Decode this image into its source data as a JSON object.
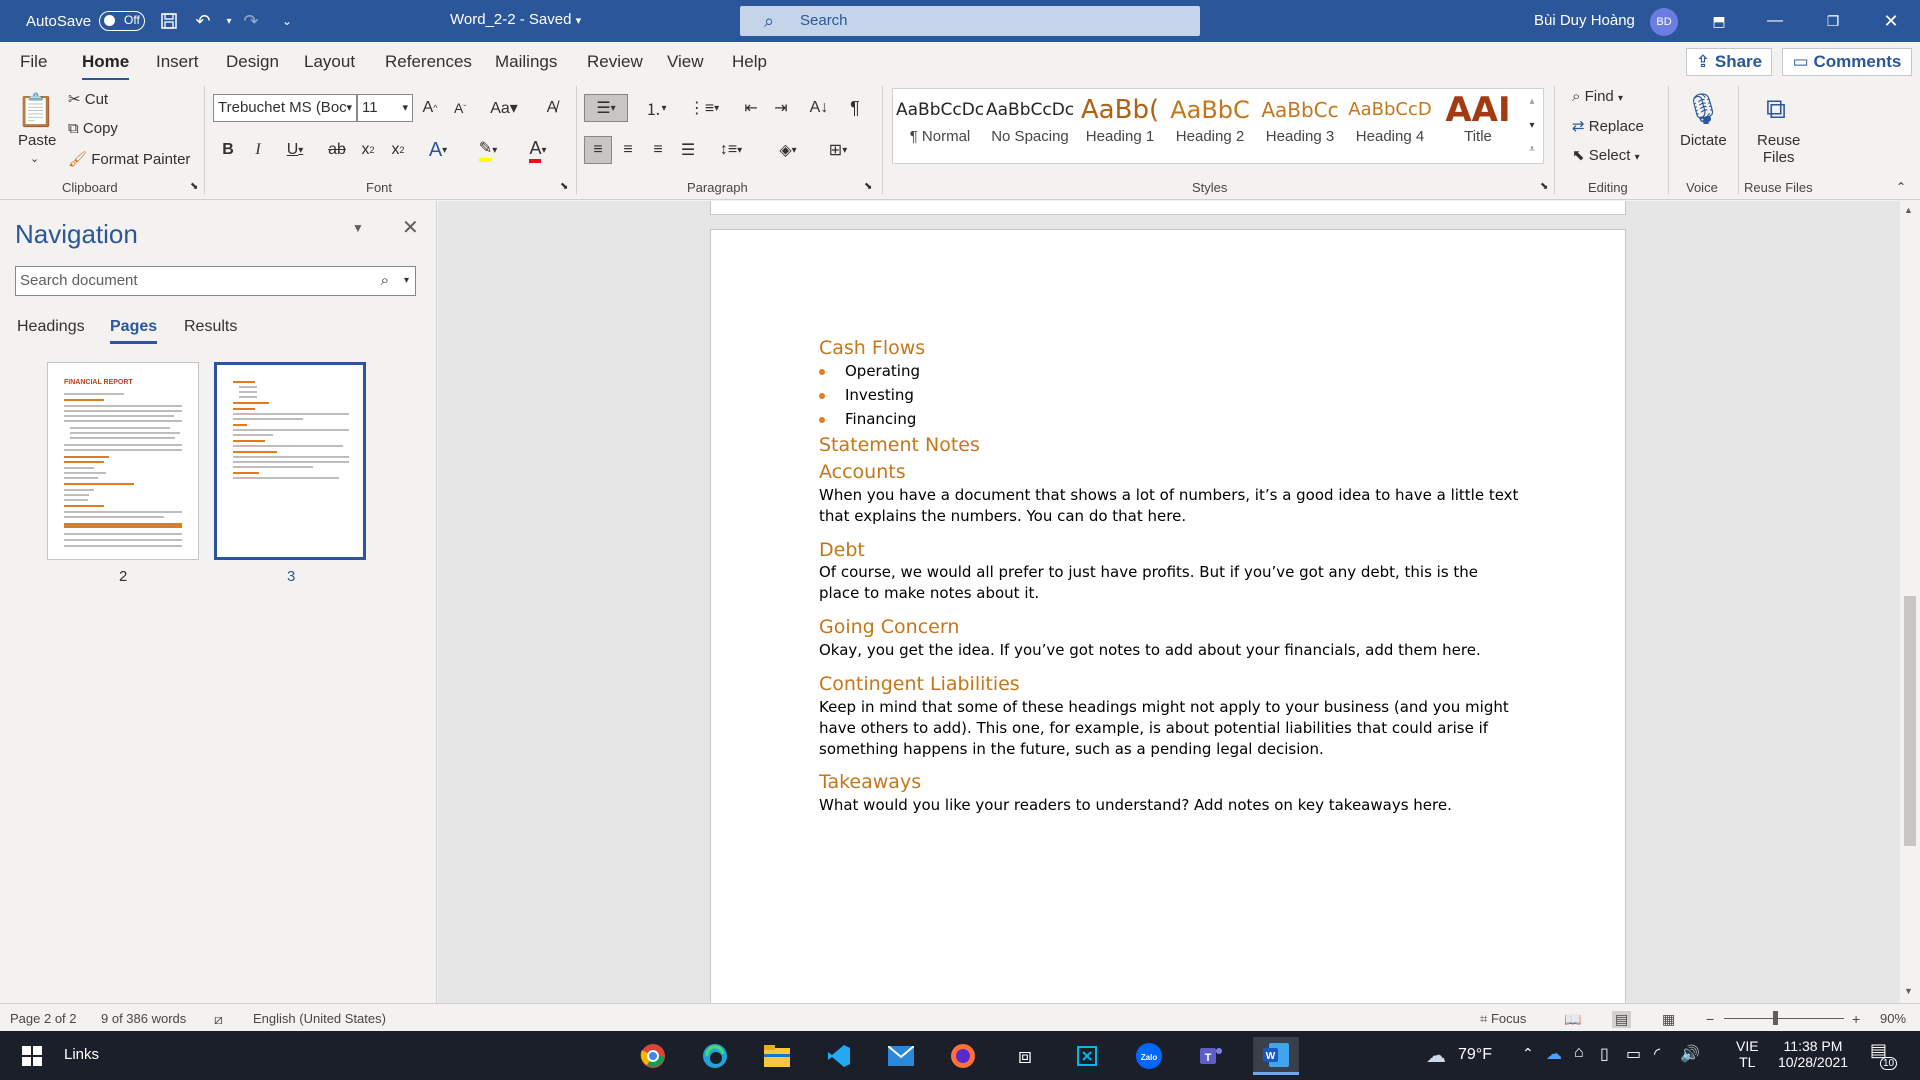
{
  "titlebar": {
    "autosave_label": "AutoSave",
    "autosave_state": "Off",
    "doc_title": "Word_2-2 - Saved",
    "search_placeholder": "Search",
    "user_name": "Bùi Duy Hoàng",
    "user_initials": "BD"
  },
  "menu": {
    "tabs": [
      "File",
      "Home",
      "Insert",
      "Design",
      "Layout",
      "References",
      "Mailings",
      "Review",
      "View",
      "Help"
    ],
    "share": "Share",
    "comments": "Comments"
  },
  "ribbon": {
    "clipboard": {
      "paste": "Paste",
      "cut": "Cut",
      "copy": "Copy",
      "format_painter": "Format Painter",
      "label": "Clipboard"
    },
    "font": {
      "family": "Trebuchet MS (Boc",
      "size": "11",
      "label": "Font"
    },
    "paragraph": {
      "label": "Paragraph"
    },
    "styles": {
      "label": "Styles",
      "items": [
        {
          "sample": "AaBbCcDc",
          "name": "¶ Normal"
        },
        {
          "sample": "AaBbCcDc",
          "name": "No Spacing"
        },
        {
          "sample": "AaBb(",
          "name": "Heading 1"
        },
        {
          "sample": "AaBbC",
          "name": "Heading 2"
        },
        {
          "sample": "AaBbCc",
          "name": "Heading 3"
        },
        {
          "sample": "AaBbCcD",
          "name": "Heading 4"
        },
        {
          "sample": "AAI",
          "name": "Title"
        }
      ]
    },
    "editing": {
      "find": "Find",
      "replace": "Replace",
      "select": "Select",
      "label": "Editing"
    },
    "voice": {
      "dictate": "Dictate",
      "label": "Voice"
    },
    "reuse": {
      "reuse": "Reuse",
      "files": "Files",
      "label": "Reuse Files"
    }
  },
  "navigation": {
    "title": "Navigation",
    "search_placeholder": "Search document",
    "tabs": [
      "Headings",
      "Pages",
      "Results"
    ],
    "thumb_title": "FINANCIAL REPORT",
    "pages": [
      "2",
      "3"
    ]
  },
  "document": {
    "h_cash_flows": "Cash Flows",
    "bullets": [
      "Operating",
      "Investing",
      "Financing"
    ],
    "h_statement_notes": "Statement Notes",
    "h_accounts": "Accounts",
    "p_accounts_1": "When you have a document that shows a lot of numbers, it’s a good idea to have a little text",
    "p_accounts_2": "that explains the numbers. You can do that here.",
    "h_debt": "Debt",
    "p_debt_1": "Of course, we would all prefer to just have profits. But if you’ve got any debt, this is the",
    "p_debt_2": "place to make notes about it.",
    "h_going_concern": "Going Concern",
    "p_going_concern": "Okay, you get the idea. If you’ve got notes to add about your financials, add them here.",
    "h_contingent": "Contingent Liabilities",
    "p_contingent_1": "Keep in mind that some of these headings might not apply to your business (and you might",
    "p_contingent_2": "have others to add). This one, for example, is about potential liabilities that could arise if",
    "p_contingent_3": "something happens in the future, such as a pending legal decision.",
    "h_takeaways": "Takeaways",
    "p_takeaways": "What would you like your readers to understand? Add notes on key takeaways here."
  },
  "statusbar": {
    "page": "Page 2 of 2",
    "words": "9 of 386 words",
    "language": "English (United States)",
    "focus": "Focus",
    "zoom": "90%"
  },
  "taskbar": {
    "links": "Links",
    "temperature": "79°F",
    "lang_1": "VIE",
    "lang_2": "TL",
    "time": "11:38 PM",
    "date": "10/28/2021",
    "notifications": "10"
  }
}
